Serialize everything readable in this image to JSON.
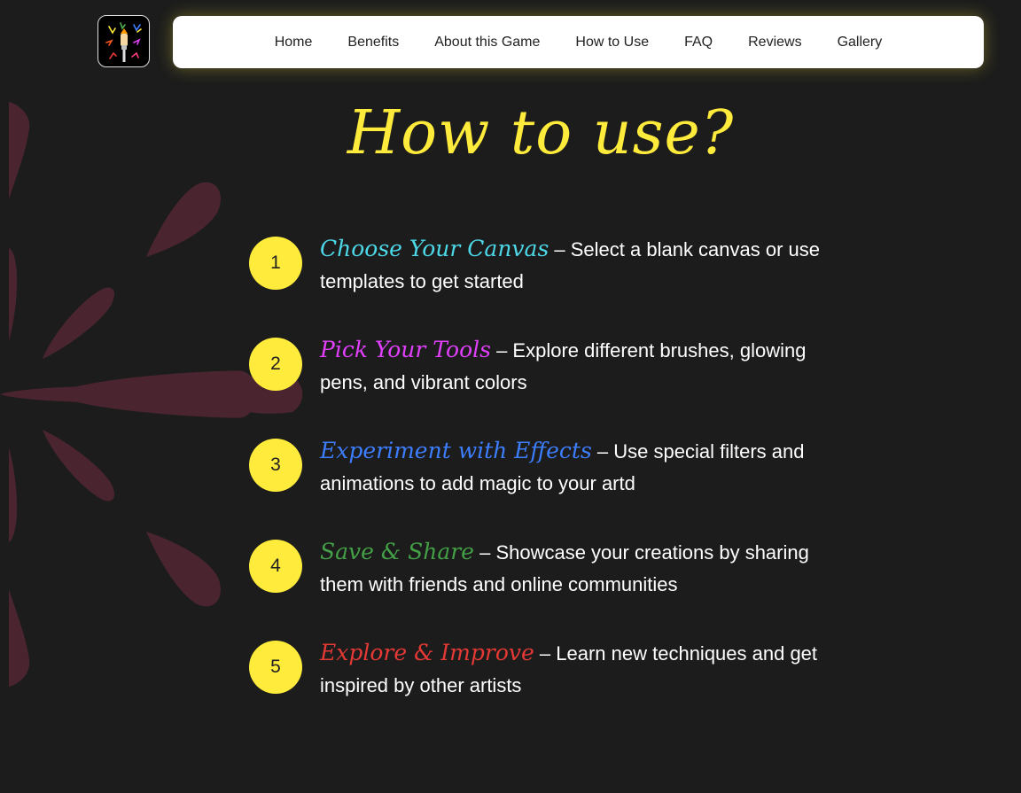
{
  "header": {
    "logo_icon": "paintbrush-burst-icon",
    "nav": [
      {
        "label": "Home"
      },
      {
        "label": "Benefits"
      },
      {
        "label": "About this Game"
      },
      {
        "label": "How to Use"
      },
      {
        "label": "FAQ"
      },
      {
        "label": "Reviews"
      },
      {
        "label": "Gallery"
      }
    ]
  },
  "main": {
    "title": "How to use?",
    "steps": [
      {
        "number": "1",
        "title": "Choose Your Canvas",
        "description": " – Select a blank canvas or use templates to get started",
        "color": "#4dd8e8"
      },
      {
        "number": "2",
        "title": "Pick Your Tools",
        "description": " – Explore different brushes, glowing pens, and vibrant colors",
        "color": "#e040fb"
      },
      {
        "number": "3",
        "title": "Experiment with Effects",
        "description": " – Use special filters and animations to add magic to your artd",
        "color": "#3d7eff"
      },
      {
        "number": "4",
        "title": "Save & Share",
        "description": " – Showcase your creations by sharing them with friends and online communities",
        "color": "#43a047"
      },
      {
        "number": "5",
        "title": "Explore & Improve",
        "description": " – Learn new techniques and get inspired by other artists",
        "color": "#e53935"
      }
    ]
  },
  "colors": {
    "background": "#1c1c1c",
    "accent": "#ffeb3b",
    "decor": "#4a2530",
    "nav_background": "#ffffff"
  }
}
